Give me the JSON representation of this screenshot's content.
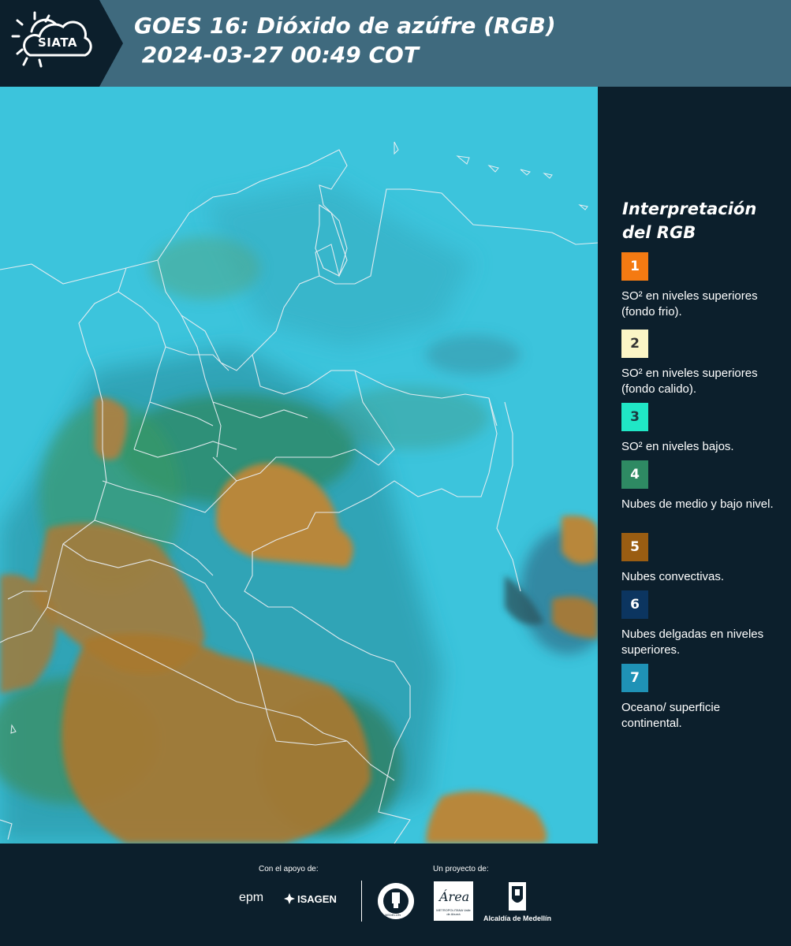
{
  "header": {
    "logo_text": "SIATA",
    "title": "GOES 16: Dióxido de azúfre (RGB)\n 2024-03-27 00:49 COT"
  },
  "map": {
    "ocean_color": "#3cc4dc",
    "border_color": "#e8eef2"
  },
  "legend": {
    "title": "Interpretación del RGB",
    "items": [
      {
        "number": "1",
        "color": "#f47a12",
        "text_color": "#ffffff",
        "label": "SO² en niveles superiores (fondo frio)."
      },
      {
        "number": "2",
        "color": "#fbf5c6",
        "text_color": "#333333",
        "label": "SO² en niveles superiores (fondo calido)."
      },
      {
        "number": "3",
        "color": "#20e7c6",
        "text_color": "#1a3a40",
        "label": "SO² en niveles bajos."
      },
      {
        "number": "4",
        "color": "#2e8a63",
        "text_color": "#ffffff",
        "label": "Nubes de medio y bajo nivel."
      },
      {
        "number": "5",
        "color": "#9a5d12",
        "text_color": "#ffffff",
        "label": "Nubes convectivas."
      },
      {
        "number": "6",
        "color": "#0c3560",
        "text_color": "#ffffff",
        "label": "Nubes delgadas en niveles superiores."
      },
      {
        "number": "7",
        "color": "#1f92b6",
        "text_color": "#ffffff",
        "label": "Oceano/ superficie continental."
      }
    ]
  },
  "footer": {
    "support_label": "Con el apoyo de:",
    "project_label": "Un proyecto de:",
    "sponsor_1": "epm",
    "sponsor_2": "ISAGEN",
    "partner_1": "MEDELLÍN",
    "partner_2": "Área",
    "partner_2_sub": "METROPOLITANA Valle de Aburrá",
    "partner_3": "Alcaldía de Medellín"
  }
}
